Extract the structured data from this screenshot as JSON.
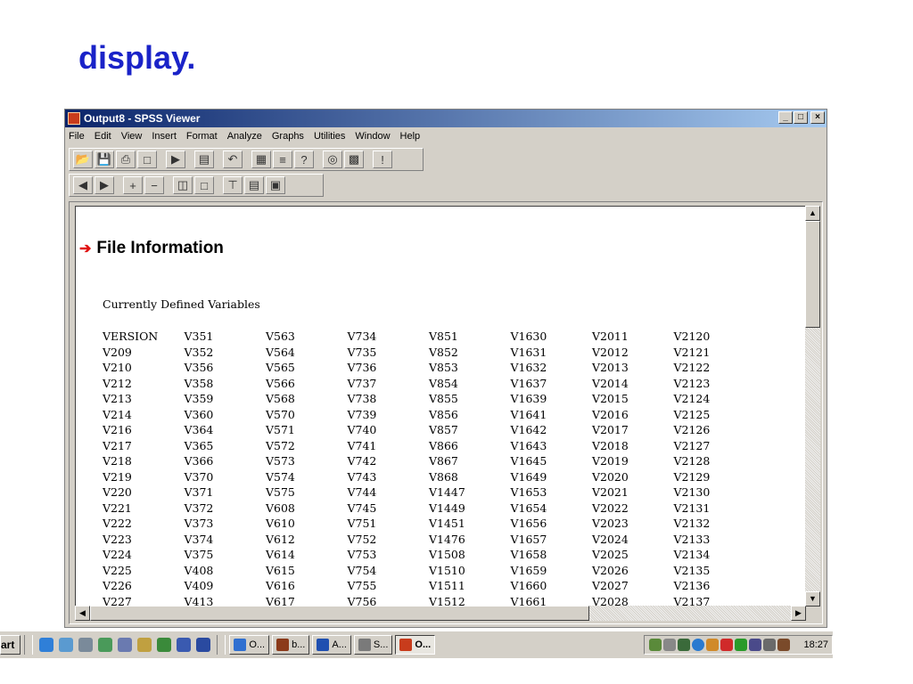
{
  "slide": {
    "title": "display."
  },
  "window": {
    "title": "Output8 - SPSS Viewer",
    "controls": [
      "_",
      "□",
      "×"
    ]
  },
  "menu": [
    "File",
    "Edit",
    "View",
    "Insert",
    "Format",
    "Analyze",
    "Graphs",
    "Utilities",
    "Window",
    "Help"
  ],
  "toolbar1": [
    "open-icon",
    "save-icon",
    "print-icon",
    "print-preview-icon",
    "export-icon",
    "recall-dialog-icon",
    "undo-icon",
    "goto-data-icon",
    "goto-case-icon",
    "variables-icon",
    "select-cases-icon",
    "insert-chart-icon",
    "run-icon"
  ],
  "toolbar2": [
    "promote-icon",
    "demote-icon",
    "expand-icon",
    "collapse-icon",
    "show-icon",
    "hide-icon",
    "insert-heading-icon",
    "insert-title-icon",
    "insert-text-icon"
  ],
  "content": {
    "heading": "File Information",
    "subheading": "Currently Defined Variables",
    "rows": [
      [
        "VERSION",
        "V351",
        "V563",
        "V734",
        "V851",
        "V1630",
        "V2011",
        "V2120"
      ],
      [
        "V209",
        "V352",
        "V564",
        "V735",
        "V852",
        "V1631",
        "V2012",
        "V2121"
      ],
      [
        "V210",
        "V356",
        "V565",
        "V736",
        "V853",
        "V1632",
        "V2013",
        "V2122"
      ],
      [
        "V212",
        "V358",
        "V566",
        "V737",
        "V854",
        "V1637",
        "V2014",
        "V2123"
      ],
      [
        "V213",
        "V359",
        "V568",
        "V738",
        "V855",
        "V1639",
        "V2015",
        "V2124"
      ],
      [
        "V214",
        "V360",
        "V570",
        "V739",
        "V856",
        "V1641",
        "V2016",
        "V2125"
      ],
      [
        "V216",
        "V364",
        "V571",
        "V740",
        "V857",
        "V1642",
        "V2017",
        "V2126"
      ],
      [
        "V217",
        "V365",
        "V572",
        "V741",
        "V866",
        "V1643",
        "V2018",
        "V2127"
      ],
      [
        "V218",
        "V366",
        "V573",
        "V742",
        "V867",
        "V1645",
        "V2019",
        "V2128"
      ],
      [
        "V219",
        "V370",
        "V574",
        "V743",
        "V868",
        "V1649",
        "V2020",
        "V2129"
      ],
      [
        "V220",
        "V371",
        "V575",
        "V744",
        "V1447",
        "V1653",
        "V2021",
        "V2130"
      ],
      [
        "V221",
        "V372",
        "V608",
        "V745",
        "V1449",
        "V1654",
        "V2022",
        "V2131"
      ],
      [
        "V222",
        "V373",
        "V610",
        "V751",
        "V1451",
        "V1656",
        "V2023",
        "V2132"
      ],
      [
        "V223",
        "V374",
        "V612",
        "V752",
        "V1476",
        "V1657",
        "V2024",
        "V2133"
      ],
      [
        "V224",
        "V375",
        "V614",
        "V753",
        "V1508",
        "V1658",
        "V2025",
        "V2134"
      ],
      [
        "V225",
        "V408",
        "V615",
        "V754",
        "V1510",
        "V1659",
        "V2026",
        "V2135"
      ],
      [
        "V226",
        "V409",
        "V616",
        "V755",
        "V1511",
        "V1660",
        "V2027",
        "V2136"
      ],
      [
        "V227",
        "V413",
        "V617",
        "V756",
        "V1512",
        "V1661",
        "V2028",
        "V2137"
      ]
    ]
  },
  "taskbar": {
    "start_label": "art",
    "tasks": [
      {
        "label": "O...",
        "color": "#2f6fd0"
      },
      {
        "label": "b...",
        "color": "#8b3a1a"
      },
      {
        "label": "A...",
        "color": "#1f4fb0"
      },
      {
        "label": "S...",
        "color": "#7a7a7a"
      },
      {
        "label": "O...",
        "color": "#c83c1c",
        "active": true
      }
    ],
    "clock": "18:27"
  }
}
